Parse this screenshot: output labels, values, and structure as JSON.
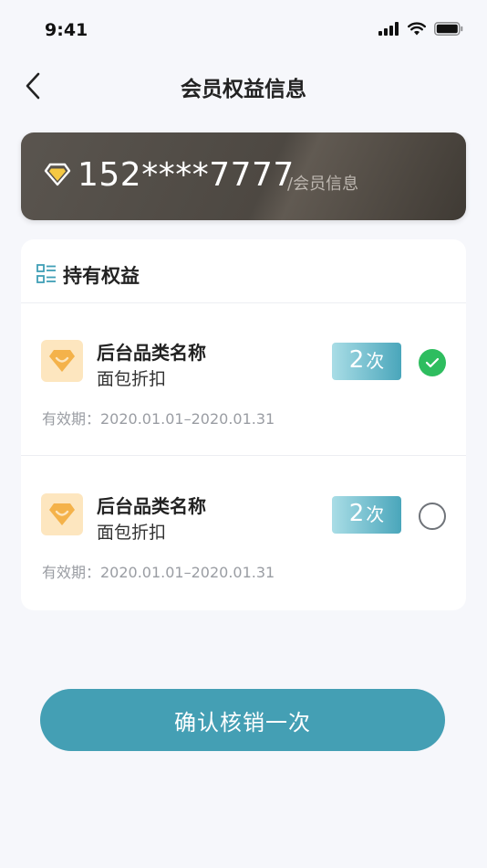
{
  "status_bar": {
    "time": "9:41",
    "icons": [
      "signal-icon",
      "wifi-icon",
      "battery-icon"
    ]
  },
  "nav": {
    "back_icon": "chevron-left-icon",
    "title": "会员权益信息"
  },
  "member_card": {
    "icon": "diamond-icon",
    "phone": "152****7777",
    "subtitle": "/会员信息"
  },
  "benefits_panel": {
    "icon": "list-icon",
    "title": "持有权益",
    "items": [
      {
        "icon": "category-icon",
        "name": "后台品类名称",
        "desc": "面包折扣",
        "count": "2",
        "unit": "次",
        "validity": "有效期：2020.01.01–2020.01.31",
        "selected": true
      },
      {
        "icon": "category-icon",
        "name": "后台品类名称",
        "desc": "面包折扣",
        "count": "2",
        "unit": "次",
        "validity": "有效期：2020.01.01–2020.01.31",
        "selected": false
      }
    ]
  },
  "confirm_button": {
    "label": "确认核销一次"
  },
  "colors": {
    "accent": "#449fb4",
    "check": "#2ebd5f",
    "card_dark": "#4d4842",
    "badge_start": "#a9dde6",
    "badge_end": "#4aa6bb",
    "icon_bg": "#fde6bf",
    "icon_fg": "#f4b24a"
  }
}
